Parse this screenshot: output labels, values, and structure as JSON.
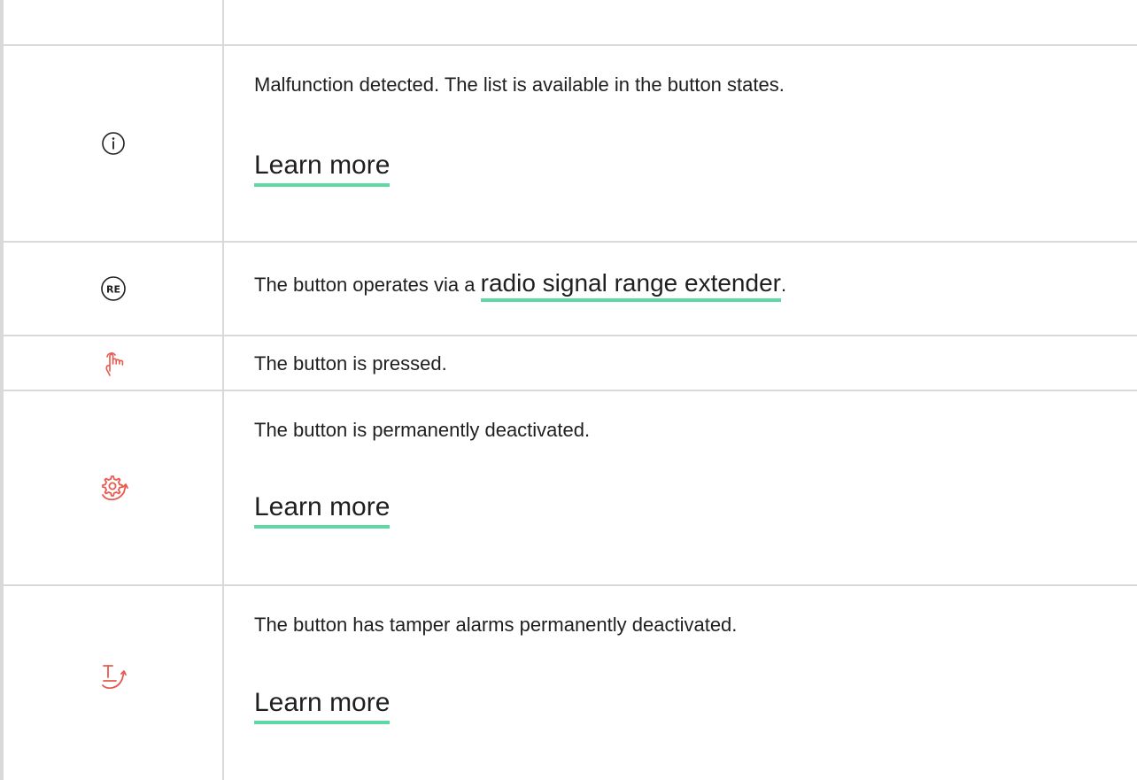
{
  "colors": {
    "border": "#d9d9d9",
    "link_underline": "#5ed9a4",
    "alert_icon": "#e85a4f",
    "text": "#1f1f1f"
  },
  "rows": [
    {
      "icon": "info-circle-icon",
      "text": "Malfunction detected. The list is available in the button states.",
      "link": "Learn more"
    },
    {
      "icon": "range-extender-re-icon",
      "icon_text": "RE",
      "text_before": "The button operates via a ",
      "link": "radio signal range extender",
      "text_after": "."
    },
    {
      "icon": "hand-pressed-icon",
      "text": "The button is pressed."
    },
    {
      "icon": "gear-deactivated-icon",
      "text": "The button is permanently deactivated.",
      "link": "Learn more"
    },
    {
      "icon": "tamper-deactivated-icon",
      "text": "The button has tamper alarms permanently deactivated.",
      "link": "Learn more"
    }
  ]
}
